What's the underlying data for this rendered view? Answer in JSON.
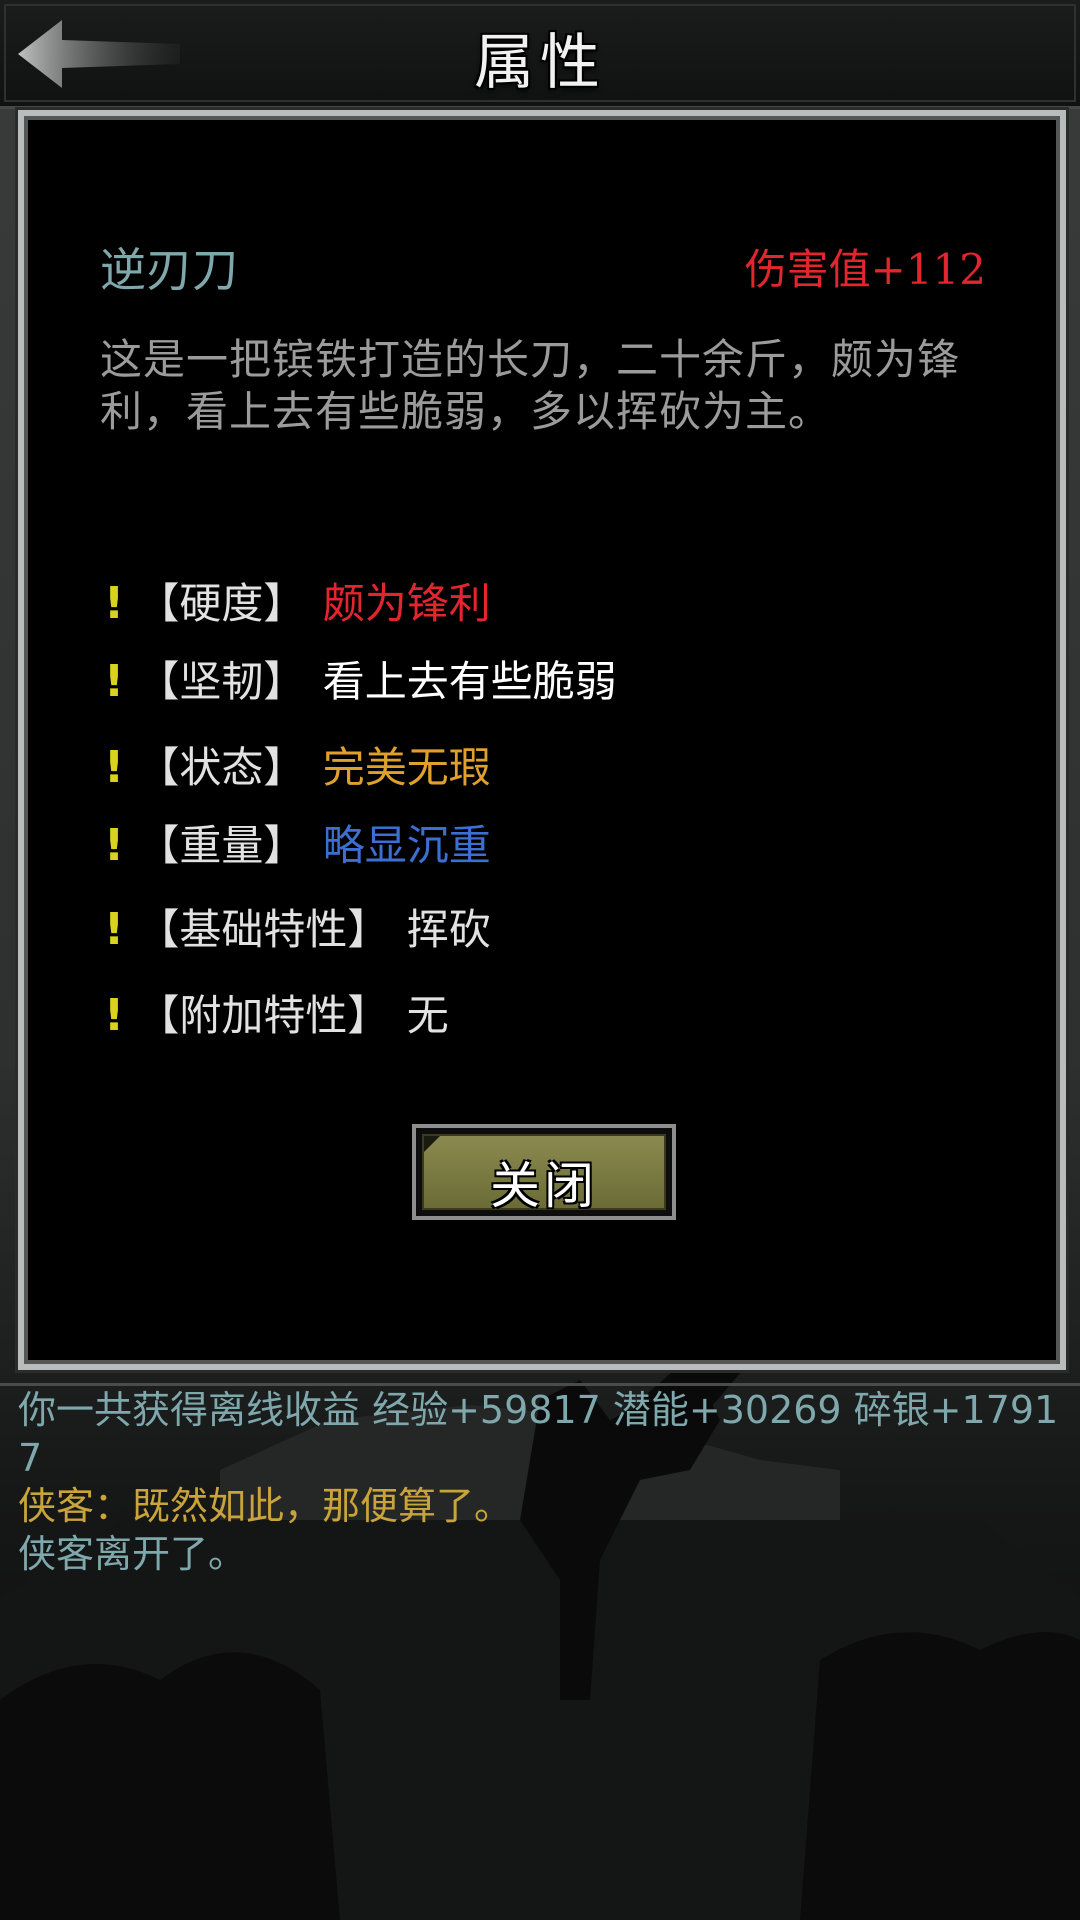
{
  "header": {
    "title": "属性",
    "back_icon": "arrow-left-icon"
  },
  "item": {
    "name": "逆刃刀",
    "damage": "伤害值+112",
    "description": "这是一把镔铁打造的长刀，二十余斤，颇为锋利，看上去有些脆弱，多以挥砍为主。"
  },
  "attributes": [
    {
      "mark": "!",
      "key": "【硬度】",
      "value": "颇为锋利",
      "color": "#e3262d"
    },
    {
      "mark": "!",
      "key": "【坚韧】",
      "value": "看上去有些脆弱",
      "color": "#ffffff"
    },
    {
      "mark": "!",
      "key": "【状态】",
      "value": "完美无瑕",
      "color": "#e0a12c"
    },
    {
      "mark": "!",
      "key": "【重量】",
      "value": "略显沉重",
      "color": "#3b6fd1"
    },
    {
      "mark": "!",
      "key": "【基础特性】",
      "value": "挥砍",
      "color": "#e2e2e2"
    },
    {
      "mark": "!",
      "key": "【附加特性】",
      "value": "无",
      "color": "#e2e2e2"
    }
  ],
  "close_label": "关闭",
  "log": [
    {
      "text": "你一共获得离线收益 经验+59817 潜能+30269 碎银+17917",
      "color": "#7fa8ad"
    },
    {
      "text": "侠客：既然如此，那便算了。",
      "color": "#c9a43a"
    },
    {
      "text": "侠客离开了。",
      "color": "#7fa8ad"
    }
  ]
}
